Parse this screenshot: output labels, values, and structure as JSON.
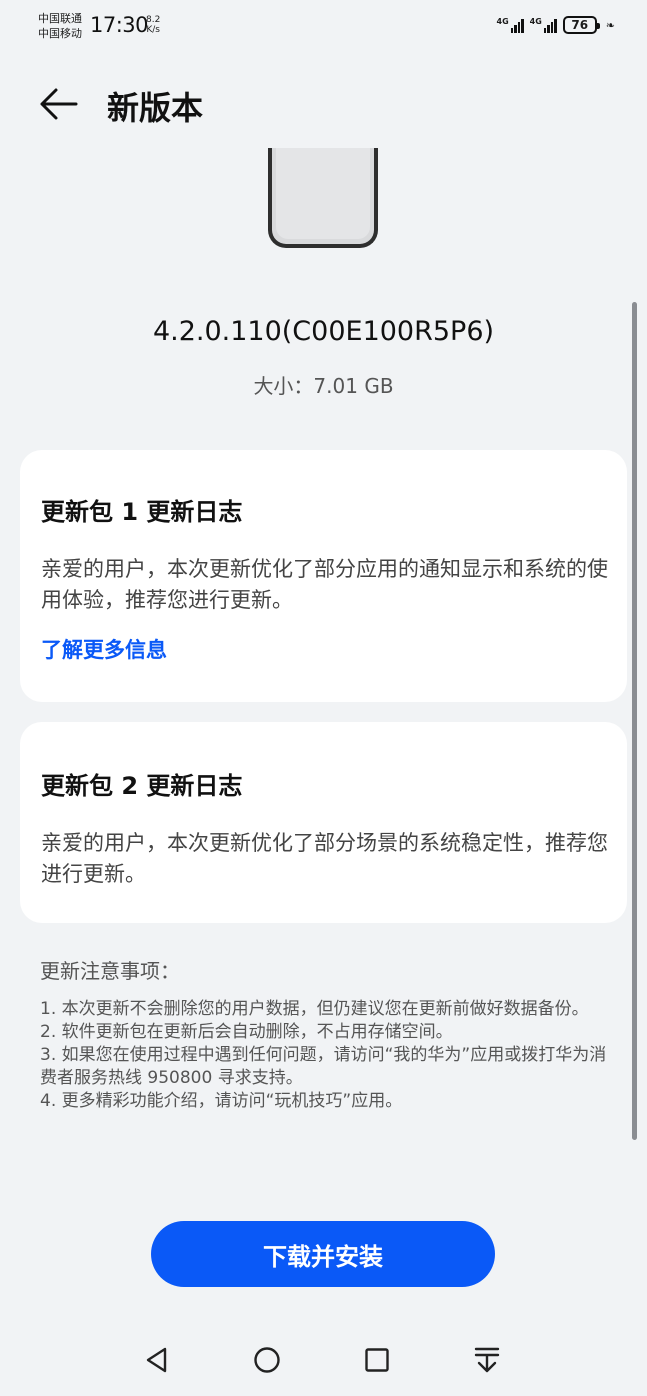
{
  "status_bar": {
    "carrier_1": "中国联通",
    "carrier_2": "中国移动",
    "time": "17:30",
    "net_speed_value": "8.2",
    "net_speed_unit": "K/s",
    "signal_1_label": "4G",
    "signal_2_label": "4G",
    "battery": "76"
  },
  "header": {
    "back_icon": "arrow-left-icon",
    "title": "新版本"
  },
  "version_info": {
    "version": "4.2.0.110(C00E100R5P6)",
    "size": "大小：7.01 GB"
  },
  "packages": [
    {
      "title": "更新包 1 更新日志",
      "body": "亲爱的用户，本次更新优化了部分应用的通知显示和系统的使用体验，推荐您进行更新。",
      "link": "了解更多信息"
    },
    {
      "title": "更新包 2 更新日志",
      "body": "亲爱的用户，本次更新优化了部分场景的系统稳定性，推荐您进行更新。"
    }
  ],
  "notes": {
    "title": "更新注意事项：",
    "items": [
      "1. 本次更新不会删除您的用户数据，但仍建议您在更新前做好数据备份。",
      "2. 软件更新包在更新后会自动删除，不占用存储空间。",
      "3. 如果您在使用过程中遇到任何问题，请访问“我的华为”应用或拨打华为消费者服务热线 950800 寻求支持。",
      "4. 更多精彩功能介绍，请访问“玩机技巧”应用。"
    ]
  },
  "actions": {
    "download_install": "下载并安装"
  },
  "navigation": {
    "back": "triangle-back-icon",
    "home": "circle-home-icon",
    "recents": "square-recents-icon",
    "notifications": "pull-down-icon"
  },
  "colors": {
    "accent": "#0a59f7",
    "background": "#f1f3f5",
    "card": "#ffffff"
  }
}
